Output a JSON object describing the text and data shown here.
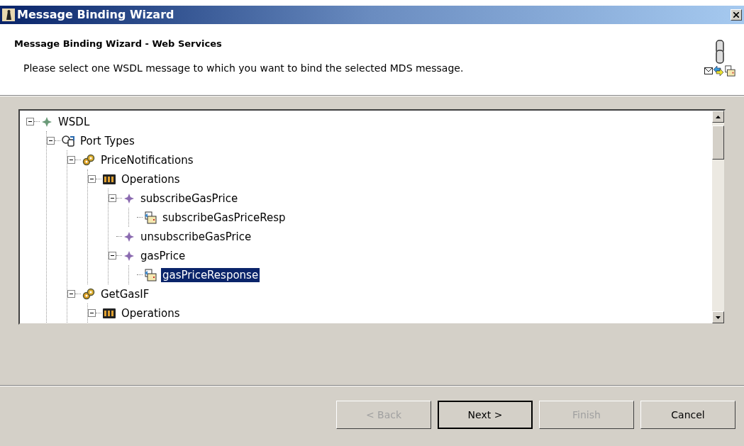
{
  "window": {
    "title": "Message Binding Wizard"
  },
  "header": {
    "title": "Message Binding Wizard - Web Services",
    "description": "Please select one WSDL message to which you want to bind the selected MDS message."
  },
  "tree": [
    {
      "label": "WSDL",
      "kind": "root",
      "expanded": true,
      "selected": false,
      "children": [
        {
          "label": "Port Types",
          "kind": "porttypes",
          "expanded": true,
          "selected": false,
          "children": [
            {
              "label": "PriceNotifications",
              "kind": "porttype",
              "expanded": true,
              "selected": false,
              "children": [
                {
                  "label": "Operations",
                  "kind": "operations",
                  "expanded": true,
                  "selected": false,
                  "children": [
                    {
                      "label": "subscribeGasPrice",
                      "kind": "operation",
                      "expanded": true,
                      "selected": false,
                      "children": [
                        {
                          "label": "subscribeGasPriceResp",
                          "kind": "message",
                          "selected": false
                        }
                      ]
                    },
                    {
                      "label": "unsubscribeGasPrice",
                      "kind": "operation",
                      "selected": false
                    },
                    {
                      "label": "gasPrice",
                      "kind": "operation",
                      "expanded": true,
                      "selected": false,
                      "children": [
                        {
                          "label": "gasPriceResponse",
                          "kind": "message",
                          "selected": true
                        }
                      ]
                    }
                  ]
                }
              ]
            },
            {
              "label": "GetGasIF",
              "kind": "porttype",
              "expanded": true,
              "selected": false,
              "children": [
                {
                  "label": "Operations",
                  "kind": "operations",
                  "expanded": true,
                  "selected": false
                }
              ]
            }
          ]
        }
      ]
    }
  ],
  "buttons": [
    {
      "label": "< Back",
      "disabled": true,
      "default": false
    },
    {
      "label": "Next >",
      "disabled": false,
      "default": true
    },
    {
      "label": "Finish",
      "disabled": true,
      "default": false
    },
    {
      "label": "Cancel",
      "disabled": false,
      "default": false
    }
  ]
}
